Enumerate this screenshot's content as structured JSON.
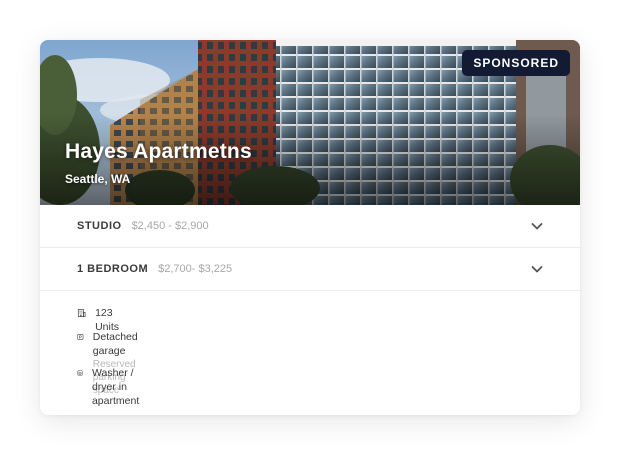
{
  "listing": {
    "title": "Hayes Apartmetns",
    "location": "Seattle, WA",
    "badge": "SPONSORED"
  },
  "units": [
    {
      "type": "STUDIO",
      "price": "$2,450 - $2,900"
    },
    {
      "type": "1 BEDROOM",
      "price": "$2,700- $3,225"
    }
  ],
  "features": [
    {
      "icon": "building-icon",
      "label": "123 Units",
      "sub": ""
    },
    {
      "icon": "parking-icon",
      "label": "Detached garage",
      "sub": "Reserved parking space"
    },
    {
      "icon": "washer-icon",
      "label": "Washer / dryer in apartment",
      "sub": ""
    }
  ],
  "colors": {
    "badge_bg": "#131a33",
    "label_text": "#3a3a3a",
    "price_text": "#a8a8a8",
    "divider": "#ececec"
  }
}
